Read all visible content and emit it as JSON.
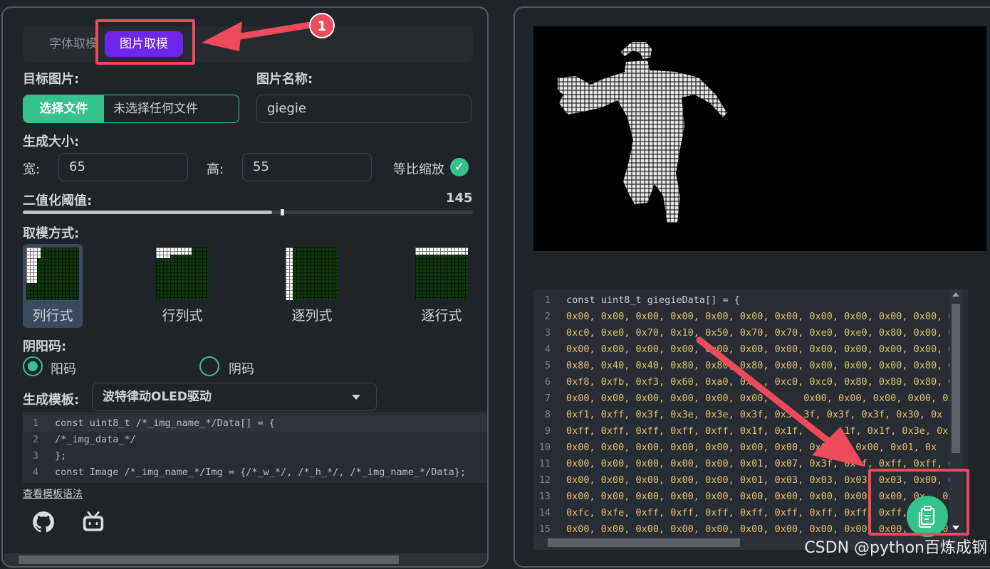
{
  "left": {
    "tabs": {
      "font": "字体取模",
      "image": "图片取模"
    },
    "target_image_label": "目标图片:",
    "file_button": "选择文件",
    "file_status": "未选择任何文件",
    "image_name_label": "图片名称:",
    "image_name_value": "giegie",
    "size_label": "生成大小:",
    "width_label": "宽:",
    "width_value": "65",
    "height_label": "高:",
    "height_value": "55",
    "keep_ratio_label": "等比缩放",
    "keep_ratio_checked": true,
    "threshold_label": "二值化阈值:",
    "threshold_value": "145",
    "mode_label": "取模方式:",
    "modes": [
      "列行式",
      "行列式",
      "逐列式",
      "逐行式"
    ],
    "mode_selected": 0,
    "polarity_label": "阴阳码:",
    "polarity_options": [
      "阳码",
      "阴码"
    ],
    "polarity_selected": 0,
    "template_label": "生成模板:",
    "template_value": "波特律动OLED驱动",
    "template_code": [
      "const uint8_t /*_img_name_*/Data[] = {",
      "/*_img_data_*/",
      "};",
      "const Image /*_img_name_*/Img = {/*_w_*/, /*_h_*/, /*_img_name_*/Data};"
    ],
    "template_syntax_link": "查看模板语法",
    "footer_icons": [
      "github-icon",
      "bilibili-icon"
    ]
  },
  "right": {
    "code_lines": [
      "const uint8_t giegieData[] = {",
      "0x00, 0x00, 0x00, 0x00, 0x00, 0x00, 0x00, 0x00, 0x00, 0x00, 0x00, 0x",
      "0xc0, 0xe0, 0x70, 0x10, 0x50, 0x70, 0x70, 0xe0, 0xe0, 0x80, 0x00, 0x",
      "0x00, 0x00, 0x00, 0x00, 0x00, 0x00, 0x00, 0x00, 0x00, 0x00, 0x00, 0x",
      "0x80, 0x40, 0x40, 0x80, 0x80, 0x80, 0x00, 0x00, 0x00, 0x00, 0x00, 0x",
      "0xf8, 0xfb, 0xf3, 0x60, 0xa0, 0x  , 0xc0, 0xc0, 0x80, 0x80, 0x80, 0x",
      "0x00, 0x00, 0x00, 0x00, 0x00, 0x00,      0x00, 0x00, 0x00, 0x00, 0x",
      "0xf1, 0xff, 0x3f, 0x3e, 0x3e, 0x3f, 0x3  3f, 0x3f, 0x3f, 0x30, 0x",
      "0xff, 0xff, 0xff, 0xff, 0xff, 0x1f, 0x1f,       1f, 0x1f, 0x3e, 0x",
      "0x00, 0x00, 0x00, 0x00, 0x00, 0x00, 0x00, 0x0  0, 0x00, 0x01, 0x",
      "0x00, 0x00, 0x00, 0x00, 0x00, 0x01, 0x07, 0x3f, 0x f, 0xff, 0xff, 0x",
      "0x00, 0x00, 0x00, 0x00, 0x00, 0x01, 0x03, 0x03, 0x03, 0x03, 0x00, 0x",
      "0x00, 0x00, 0x00, 0x00, 0x00, 0x00, 0x00, 0x00, 0x00, 0x00, 0x   0x",
      "0xfc, 0xfe, 0xff, 0xff, 0xff, 0xff, 0xff, 0xff, 0xff, 0xff,      x",
      "0x00, 0x00, 0x00, 0x00, 0x00, 0x00, 0x00, 0x00, 0x00, 0x00, 0x   0x"
    ],
    "copy_button_icon": "clipboard-icon"
  },
  "annotation": {
    "step_badge": "1"
  },
  "watermark": "CSDN @python百炼成钢",
  "colors": {
    "accent_green": "#36c28b",
    "accent_purple": "#6e27e8",
    "highlight_red": "#ee4b5a"
  }
}
